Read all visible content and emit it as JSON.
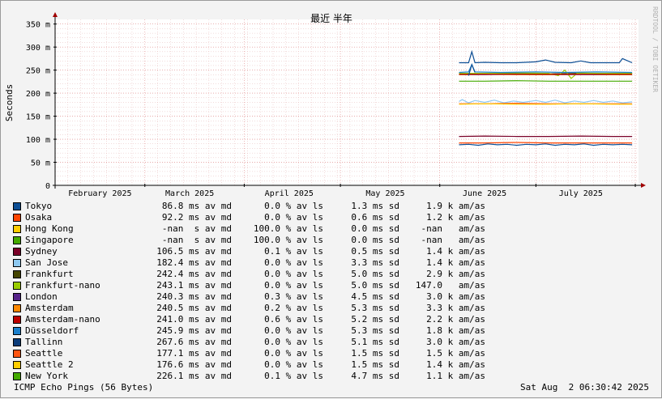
{
  "chart_data": {
    "type": "line",
    "title": "最近 半年",
    "ylabel": "Seconds",
    "watermark": "RRDTOOL / TOBI OETIKER",
    "ylim": [
      0,
      360
    ],
    "yticks": [
      {
        "v": 0,
        "label": "0"
      },
      {
        "v": 50,
        "label": "50 m"
      },
      {
        "v": 100,
        "label": "100 m"
      },
      {
        "v": 150,
        "label": "150 m"
      },
      {
        "v": 200,
        "label": "200 m"
      },
      {
        "v": 250,
        "label": "250 m"
      },
      {
        "v": 300,
        "label": "300 m"
      },
      {
        "v": 350,
        "label": "350 m"
      }
    ],
    "xlim": [
      "2025-02-01",
      "2025-08-02"
    ],
    "xticks": [
      {
        "date": "2025-02-15",
        "label": "February 2025"
      },
      {
        "date": "2025-03-15",
        "label": "March 2025"
      },
      {
        "date": "2025-04-15",
        "label": "April 2025"
      },
      {
        "date": "2025-05-15",
        "label": "May 2025"
      },
      {
        "date": "2025-06-15",
        "label": "June 2025"
      },
      {
        "date": "2025-07-15",
        "label": "July 2025"
      }
    ],
    "month_starts": [
      "2025-03-01",
      "2025-04-01",
      "2025-05-01",
      "2025-06-01",
      "2025-07-01",
      "2025-08-01"
    ],
    "data_start": "2025-06-07",
    "data_end": "2025-07-31",
    "grid": true,
    "series": [
      {
        "name": "Tokyo",
        "color": "#0d4e94",
        "level": 266,
        "values": [
          [
            "2025-06-07",
            266
          ],
          [
            "2025-06-10",
            266
          ],
          [
            "2025-06-11",
            290
          ],
          [
            "2025-06-12",
            266
          ],
          [
            "2025-06-15",
            267
          ],
          [
            "2025-06-20",
            266
          ],
          [
            "2025-06-25",
            266
          ],
          [
            "2025-07-01",
            268
          ],
          [
            "2025-07-04",
            272
          ],
          [
            "2025-07-07",
            267
          ],
          [
            "2025-07-12",
            266
          ],
          [
            "2025-07-15",
            270
          ],
          [
            "2025-07-18",
            266
          ],
          [
            "2025-07-23",
            266
          ],
          [
            "2025-07-27",
            266
          ],
          [
            "2025-07-28",
            275
          ],
          [
            "2025-07-31",
            266
          ]
        ]
      },
      {
        "name": "Osaka",
        "color": "#ff4400",
        "level": 92,
        "values": [
          [
            "2025-06-07",
            92
          ],
          [
            "2025-06-15",
            92
          ],
          [
            "2025-06-25",
            93
          ],
          [
            "2025-07-05",
            92
          ],
          [
            "2025-07-15",
            92
          ],
          [
            "2025-07-25",
            92
          ],
          [
            "2025-07-31",
            92
          ]
        ]
      },
      {
        "name": "Hong Kong",
        "color": "#ffcc00",
        "level": 176,
        "values": []
      },
      {
        "name": "Singapore",
        "color": "#44aa00",
        "level": 226,
        "values": []
      },
      {
        "name": "Sydney",
        "color": "#7a0028",
        "level": 106.5,
        "values": [
          [
            "2025-06-07",
            106
          ],
          [
            "2025-06-15",
            107
          ],
          [
            "2025-06-25",
            106
          ],
          [
            "2025-07-05",
            106
          ],
          [
            "2025-07-15",
            107
          ],
          [
            "2025-07-25",
            106
          ],
          [
            "2025-07-31",
            106
          ]
        ]
      },
      {
        "name": "San Jose",
        "color": "#8dc8f0",
        "level": 182.4,
        "values": [
          [
            "2025-06-07",
            182
          ],
          [
            "2025-06-08",
            186
          ],
          [
            "2025-06-10",
            179
          ],
          [
            "2025-06-12",
            184
          ],
          [
            "2025-06-15",
            180
          ],
          [
            "2025-06-18",
            185
          ],
          [
            "2025-06-21",
            179
          ],
          [
            "2025-06-24",
            183
          ],
          [
            "2025-06-27",
            180
          ],
          [
            "2025-07-01",
            184
          ],
          [
            "2025-07-04",
            180
          ],
          [
            "2025-07-07",
            185
          ],
          [
            "2025-07-10",
            179
          ],
          [
            "2025-07-13",
            183
          ],
          [
            "2025-07-16",
            180
          ],
          [
            "2025-07-19",
            184
          ],
          [
            "2025-07-22",
            180
          ],
          [
            "2025-07-25",
            183
          ],
          [
            "2025-07-28",
            179
          ],
          [
            "2025-07-31",
            181
          ]
        ]
      },
      {
        "name": "Frankfurt",
        "color": "#444400",
        "level": 242.4,
        "values": [
          [
            "2025-06-07",
            242
          ],
          [
            "2025-06-15",
            243
          ],
          [
            "2025-06-25",
            242
          ],
          [
            "2025-07-05",
            242
          ],
          [
            "2025-07-15",
            243
          ],
          [
            "2025-07-25",
            242
          ],
          [
            "2025-07-31",
            242
          ]
        ]
      },
      {
        "name": "Frankfurt-nano",
        "color": "#99cc00",
        "level": 243.1,
        "values": [
          [
            "2025-06-07",
            243
          ],
          [
            "2025-06-15",
            243
          ],
          [
            "2025-06-25",
            244
          ],
          [
            "2025-07-05",
            243
          ],
          [
            "2025-07-08",
            238
          ],
          [
            "2025-07-10",
            250
          ],
          [
            "2025-07-12",
            232
          ],
          [
            "2025-07-14",
            244
          ],
          [
            "2025-07-20",
            243
          ],
          [
            "2025-07-31",
            243
          ]
        ]
      },
      {
        "name": "London",
        "color": "#552288",
        "level": 240.3,
        "values": [
          [
            "2025-06-07",
            240
          ],
          [
            "2025-06-15",
            240
          ],
          [
            "2025-06-25",
            241
          ],
          [
            "2025-07-05",
            240
          ],
          [
            "2025-07-15",
            240
          ],
          [
            "2025-07-25",
            240
          ],
          [
            "2025-07-31",
            240
          ]
        ]
      },
      {
        "name": "Amsterdam",
        "color": "#ff8800",
        "level": 240.5,
        "values": [
          [
            "2025-06-07",
            240
          ],
          [
            "2025-06-15",
            241
          ],
          [
            "2025-06-25",
            240
          ],
          [
            "2025-07-05",
            240
          ],
          [
            "2025-07-15",
            241
          ],
          [
            "2025-07-25",
            240
          ],
          [
            "2025-07-31",
            240
          ]
        ]
      },
      {
        "name": "Amsterdam-nano",
        "color": "#bb0000",
        "level": 241.0,
        "values": [
          [
            "2025-06-07",
            241
          ],
          [
            "2025-06-15",
            241
          ],
          [
            "2025-06-25",
            241
          ],
          [
            "2025-07-05",
            241
          ],
          [
            "2025-07-15",
            241
          ],
          [
            "2025-07-25",
            241
          ],
          [
            "2025-07-31",
            241
          ]
        ]
      },
      {
        "name": "Düsseldorf",
        "color": "#1a7fcc",
        "level": 245.9,
        "values": [
          [
            "2025-06-07",
            245
          ],
          [
            "2025-06-10",
            246
          ],
          [
            "2025-06-11",
            262
          ],
          [
            "2025-06-12",
            246
          ],
          [
            "2025-06-20",
            245
          ],
          [
            "2025-07-01",
            246
          ],
          [
            "2025-07-10",
            245
          ],
          [
            "2025-07-20",
            246
          ],
          [
            "2025-07-31",
            245
          ]
        ]
      },
      {
        "name": "Tallinn",
        "color": "#0b3c7a",
        "level": 267.6,
        "values": []
      },
      {
        "name": "Seattle",
        "color": "#ff5511",
        "level": 177.1,
        "values": [
          [
            "2025-06-07",
            177
          ],
          [
            "2025-06-15",
            177
          ],
          [
            "2025-06-25",
            178
          ],
          [
            "2025-07-05",
            177
          ],
          [
            "2025-07-15",
            177
          ],
          [
            "2025-07-25",
            177
          ],
          [
            "2025-07-31",
            177
          ]
        ]
      },
      {
        "name": "Seattle 2",
        "color": "#ffcc00",
        "level": 176.6,
        "values": [
          [
            "2025-06-07",
            176
          ],
          [
            "2025-06-15",
            177
          ],
          [
            "2025-06-25",
            176
          ],
          [
            "2025-07-05",
            176
          ],
          [
            "2025-07-15",
            177
          ],
          [
            "2025-07-25",
            176
          ],
          [
            "2025-07-31",
            176
          ]
        ]
      },
      {
        "name": "New York",
        "color": "#44aa00",
        "level": 226.1,
        "values": [
          [
            "2025-06-07",
            226
          ],
          [
            "2025-06-15",
            226
          ],
          [
            "2025-06-25",
            227
          ],
          [
            "2025-07-05",
            226
          ],
          [
            "2025-07-15",
            226
          ],
          [
            "2025-07-25",
            226
          ],
          [
            "2025-07-31",
            226
          ]
        ]
      }
    ],
    "extra_lines": [
      {
        "color": "#0d4e94",
        "values": [
          [
            "2025-06-07",
            88
          ],
          [
            "2025-06-10",
            89
          ],
          [
            "2025-06-13",
            87
          ],
          [
            "2025-06-16",
            90
          ],
          [
            "2025-06-19",
            88
          ],
          [
            "2025-06-22",
            89
          ],
          [
            "2025-06-25",
            87
          ],
          [
            "2025-06-28",
            89
          ],
          [
            "2025-07-01",
            88
          ],
          [
            "2025-07-04",
            90
          ],
          [
            "2025-07-07",
            87
          ],
          [
            "2025-07-10",
            89
          ],
          [
            "2025-07-13",
            88
          ],
          [
            "2025-07-16",
            90
          ],
          [
            "2025-07-19",
            87
          ],
          [
            "2025-07-22",
            89
          ],
          [
            "2025-07-25",
            88
          ],
          [
            "2025-07-28",
            89
          ],
          [
            "2025-07-31",
            88
          ]
        ]
      },
      {
        "color": "#0d4e94",
        "values": [
          [
            "2025-06-10",
            238
          ],
          [
            "2025-06-11",
            262
          ],
          [
            "2025-06-12",
            245
          ]
        ]
      }
    ]
  },
  "legend": [
    {
      "name": "Tokyo",
      "color": "#0d4e94",
      "avg": "86.8 ms av md",
      "loss": "0.0 % av ls",
      "sd": "1.3 ms sd",
      "amas": "1.9 k am/as"
    },
    {
      "name": "Osaka",
      "color": "#ff4400",
      "avg": "92.2 ms av md",
      "loss": "0.0 % av ls",
      "sd": "0.6 ms sd",
      "amas": "1.2 k am/as"
    },
    {
      "name": "Hong Kong",
      "color": "#ffcc00",
      "avg": "-nan  s av md",
      "loss": "100.0 % av ls",
      "sd": "0.0 ms sd",
      "amas": "-nan   am/as"
    },
    {
      "name": "Singapore",
      "color": "#44aa00",
      "avg": "-nan  s av md",
      "loss": "100.0 % av ls",
      "sd": "0.0 ms sd",
      "amas": "-nan   am/as"
    },
    {
      "name": "Sydney",
      "color": "#7a0028",
      "avg": "106.5 ms av md",
      "loss": "0.1 % av ls",
      "sd": "0.5 ms sd",
      "amas": "1.4 k am/as"
    },
    {
      "name": "San Jose",
      "color": "#8dc8f0",
      "avg": "182.4 ms av md",
      "loss": "0.0 % av ls",
      "sd": "3.3 ms sd",
      "amas": "1.4 k am/as"
    },
    {
      "name": "Frankfurt",
      "color": "#444400",
      "avg": "242.4 ms av md",
      "loss": "0.0 % av ls",
      "sd": "5.0 ms sd",
      "amas": "2.9 k am/as"
    },
    {
      "name": "Frankfurt-nano",
      "color": "#99cc00",
      "avg": "243.1 ms av md",
      "loss": "0.0 % av ls",
      "sd": "5.0 ms sd",
      "amas": "147.0   am/as"
    },
    {
      "name": "London",
      "color": "#552288",
      "avg": "240.3 ms av md",
      "loss": "0.3 % av ls",
      "sd": "4.5 ms sd",
      "amas": "3.0 k am/as"
    },
    {
      "name": "Amsterdam",
      "color": "#ff8800",
      "avg": "240.5 ms av md",
      "loss": "0.2 % av ls",
      "sd": "5.3 ms sd",
      "amas": "3.3 k am/as"
    },
    {
      "name": "Amsterdam-nano",
      "color": "#bb0000",
      "avg": "241.0 ms av md",
      "loss": "0.6 % av ls",
      "sd": "5.2 ms sd",
      "amas": "2.2 k am/as"
    },
    {
      "name": "Düsseldorf",
      "color": "#1a7fcc",
      "avg": "245.9 ms av md",
      "loss": "0.0 % av ls",
      "sd": "5.3 ms sd",
      "amas": "1.8 k am/as"
    },
    {
      "name": "Tallinn",
      "color": "#0b3c7a",
      "avg": "267.6 ms av md",
      "loss": "0.0 % av ls",
      "sd": "5.1 ms sd",
      "amas": "3.0 k am/as"
    },
    {
      "name": "Seattle",
      "color": "#ff5511",
      "avg": "177.1 ms av md",
      "loss": "0.0 % av ls",
      "sd": "1.5 ms sd",
      "amas": "1.5 k am/as"
    },
    {
      "name": "Seattle 2",
      "color": "#ffcc00",
      "avg": "176.6 ms av md",
      "loss": "0.0 % av ls",
      "sd": "1.5 ms sd",
      "amas": "1.4 k am/as"
    },
    {
      "name": "New York",
      "color": "#44aa00",
      "avg": "226.1 ms av md",
      "loss": "0.1 % av ls",
      "sd": "4.7 ms sd",
      "amas": "1.1 k am/as"
    }
  ],
  "footer": {
    "probe": "ICMP Echo Pings (56 Bytes)",
    "timestamp": "Sat Aug  2 06:30:42 2025"
  }
}
